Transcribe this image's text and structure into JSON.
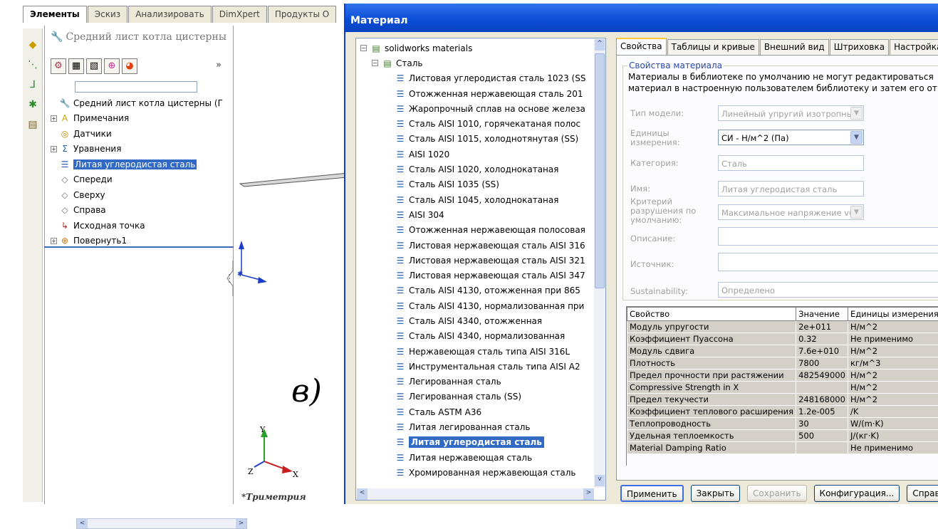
{
  "sw": {
    "tabs": [
      "Элементы",
      "Эскиз",
      "Анализировать",
      "DimXpert",
      "Продукты О"
    ],
    "panel_title": "Средний лист котла цистерны",
    "expand_glyph": "»",
    "tree": [
      {
        "label": "Средний лист котла цистерны  (Г",
        "icon": "part-icon",
        "glyph": "🔧",
        "exp": ""
      },
      {
        "label": "Примечания",
        "icon": "annotations-icon",
        "glyph": "A",
        "exp": "+"
      },
      {
        "label": "Датчики",
        "icon": "sensor-icon",
        "glyph": "◎",
        "exp": ""
      },
      {
        "label": "Уравнения",
        "icon": "equations-icon",
        "glyph": "Σ",
        "exp": "+"
      },
      {
        "label": "Литая углеродистая сталь",
        "icon": "material-icon",
        "glyph": "☰",
        "exp": "",
        "selected": true
      },
      {
        "label": "Спереди",
        "icon": "plane-icon",
        "glyph": "◇",
        "exp": ""
      },
      {
        "label": "Сверху",
        "icon": "plane-icon",
        "glyph": "◇",
        "exp": ""
      },
      {
        "label": "Справа",
        "icon": "plane-icon",
        "glyph": "◇",
        "exp": ""
      },
      {
        "label": "Исходная точка",
        "icon": "origin-icon",
        "glyph": "↳",
        "exp": ""
      },
      {
        "label": "Повернуть1",
        "icon": "revolve-icon",
        "glyph": "⊕",
        "exp": "+"
      }
    ],
    "view_label": "в)",
    "axis_x": "X",
    "axis_y": "Y",
    "axis_z": "Z",
    "view_name": "*Триметрия"
  },
  "dialog": {
    "title": "Материал",
    "materials": [
      {
        "label": "solidworks materials",
        "level": 0,
        "exp": "−",
        "icon": "library-icon"
      },
      {
        "label": "Сталь",
        "level": 1,
        "exp": "−",
        "icon": "category-icon"
      },
      {
        "label": "Листовая углеродистая сталь 1023 (SS",
        "level": 2
      },
      {
        "label": "Отожженная нержавеющая сталь 201",
        "level": 2
      },
      {
        "label": "Жаропрочный сплав на основе железа",
        "level": 2
      },
      {
        "label": "Сталь AISI 1010, горячекатаная полос",
        "level": 2
      },
      {
        "label": "Сталь AISI 1015, холоднотянутая (SS)",
        "level": 2
      },
      {
        "label": "AISI 1020",
        "level": 2
      },
      {
        "label": "Сталь AISI 1020, холоднокатаная",
        "level": 2
      },
      {
        "label": "Сталь AISI 1035 (SS)",
        "level": 2
      },
      {
        "label": "Сталь AISI 1045, холоднокатаная",
        "level": 2
      },
      {
        "label": "AISI 304",
        "level": 2
      },
      {
        "label": "Отожженная нержавеющая полосовая",
        "level": 2
      },
      {
        "label": "Листовая нержавеющая сталь AISI 316",
        "level": 2
      },
      {
        "label": "Листовая нержавеющая сталь AISI 321",
        "level": 2
      },
      {
        "label": "Листовая нержавеющая сталь AISI 347",
        "level": 2
      },
      {
        "label": "Сталь AISI 4130, отожженная при 865",
        "level": 2
      },
      {
        "label": "Сталь AISI 4130, нормализованная при",
        "level": 2
      },
      {
        "label": "Сталь AISI 4340, отожженная",
        "level": 2
      },
      {
        "label": "Сталь AISI 4340, нормализованная",
        "level": 2
      },
      {
        "label": "Нержавеющая сталь типа AISI 316L",
        "level": 2
      },
      {
        "label": "Инструментальная сталь типа AISI A2",
        "level": 2
      },
      {
        "label": "Легированная сталь",
        "level": 2
      },
      {
        "label": "Легированная сталь (SS)",
        "level": 2
      },
      {
        "label": "Сталь ASTM A36",
        "level": 2
      },
      {
        "label": "Литая легированная сталь",
        "level": 2
      },
      {
        "label": "Литая углеродистая сталь",
        "level": 2,
        "selected": true
      },
      {
        "label": "Литая нержавеющая сталь",
        "level": 2
      },
      {
        "label": "Хромированная нержавеющая сталь",
        "level": 2
      }
    ],
    "tabs": [
      "Свойства",
      "Таблицы и кривые",
      "Внешний вид",
      "Штриховка",
      "Настройка"
    ],
    "group_title": "Свойства материала",
    "note_line1": "Материалы в библиотеке по умолчанию не могут редактироваться",
    "note_line2": "материал в настроенную пользователем библиотеку и затем его от",
    "fields": {
      "model_type_label": "Тип модели:",
      "model_type_value": "Линейный упругий изотропнь",
      "units_label": "Единицы измерения:",
      "units_value": "СИ - Н/м^2 (Па)",
      "category_label": "Категория:",
      "category_value": "Сталь",
      "name_label": "Имя:",
      "name_value": "Литая углеродистая сталь",
      "failure_label": "Критерий разрушения по умолчанию:",
      "failure_value": "Максимальное напряжение v(",
      "description_label": "Описание:",
      "description_value": "",
      "source_label": "Источник:",
      "source_value": "",
      "sustainability_label": "Sustainability:",
      "sustainability_value": "Определено"
    },
    "table": {
      "headers": [
        "Свойство",
        "Значение",
        "Единицы измерения"
      ],
      "rows": [
        [
          "Модуль упругости",
          "2e+011",
          "Н/м^2"
        ],
        [
          "Коэффициент Пуассона",
          "0.32",
          "Не применимо"
        ],
        [
          "Модуль сдвига",
          "7.6e+010",
          "Н/м^2"
        ],
        [
          "Плотность",
          "7800",
          "кг/м^3"
        ],
        [
          "Предел прочности при растяжении",
          "482549000",
          "Н/м^2"
        ],
        [
          "Compressive Strength in X",
          "",
          "Н/м^2"
        ],
        [
          "Предел текучести",
          "248168000",
          "Н/м^2"
        ],
        [
          "Коэффициент теплового расширения",
          "1.2e-005",
          "/K"
        ],
        [
          "Теплопроводность",
          "30",
          "W/(m·K)"
        ],
        [
          "Удельная теплоемкость",
          "500",
          "J/(кг·K)"
        ],
        [
          "Material Damping Ratio",
          "",
          "Не применимо"
        ]
      ]
    },
    "buttons": {
      "apply": "Применить",
      "close": "Закрыть",
      "save": "Сохранить",
      "config": "Конфигурация...",
      "help": "Справка"
    }
  },
  "colors": {
    "selection": "#316ac5",
    "title_bar": "#0a4cd3",
    "dialog_bg": "#ece9d8"
  }
}
